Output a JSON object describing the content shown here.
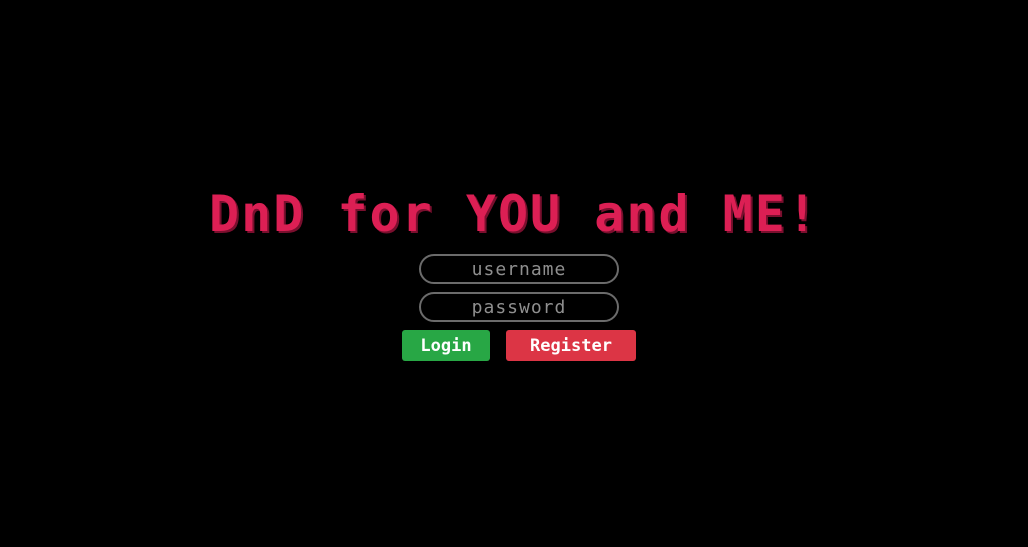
{
  "header": {
    "title": "DnD for YOU and ME!"
  },
  "login_form": {
    "username": {
      "value": "",
      "placeholder": "username"
    },
    "password": {
      "value": "",
      "placeholder": "password"
    },
    "login_label": "Login",
    "register_label": "Register"
  },
  "colors": {
    "background": "#000000",
    "title": "#dc1f54",
    "login_button": "#28a745",
    "register_button": "#dc3545",
    "field_border": "#6b6b6b"
  }
}
